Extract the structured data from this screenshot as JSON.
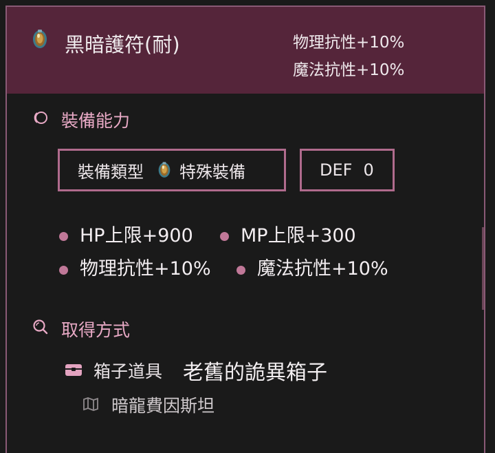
{
  "item": {
    "name": "黑暗護符(耐)",
    "icon": "amulet-icon",
    "stats": [
      "物理抗性+10%",
      "魔法抗性+10%"
    ]
  },
  "equip_section": {
    "icon": "ring-icon",
    "title": "裝備能力",
    "type_label": "裝備類型",
    "type_value": "特殊裝備",
    "def_label": "DEF",
    "def_value": "0",
    "bonuses": [
      "HP上限+900",
      "MP上限+300",
      "物理抗性+10%",
      "魔法抗性+10%"
    ]
  },
  "obtain_section": {
    "icon": "search-icon",
    "title": "取得方式",
    "source_type": "箱子道具",
    "source_name": "老舊的詭異箱子",
    "location_icon": "map-icon",
    "location": "暗龍費因斯坦"
  },
  "colors": {
    "header_bg": "#55253a",
    "accent": "#b06b8d",
    "section_title": "#e8a9c5",
    "background": "#1a1a1a"
  }
}
